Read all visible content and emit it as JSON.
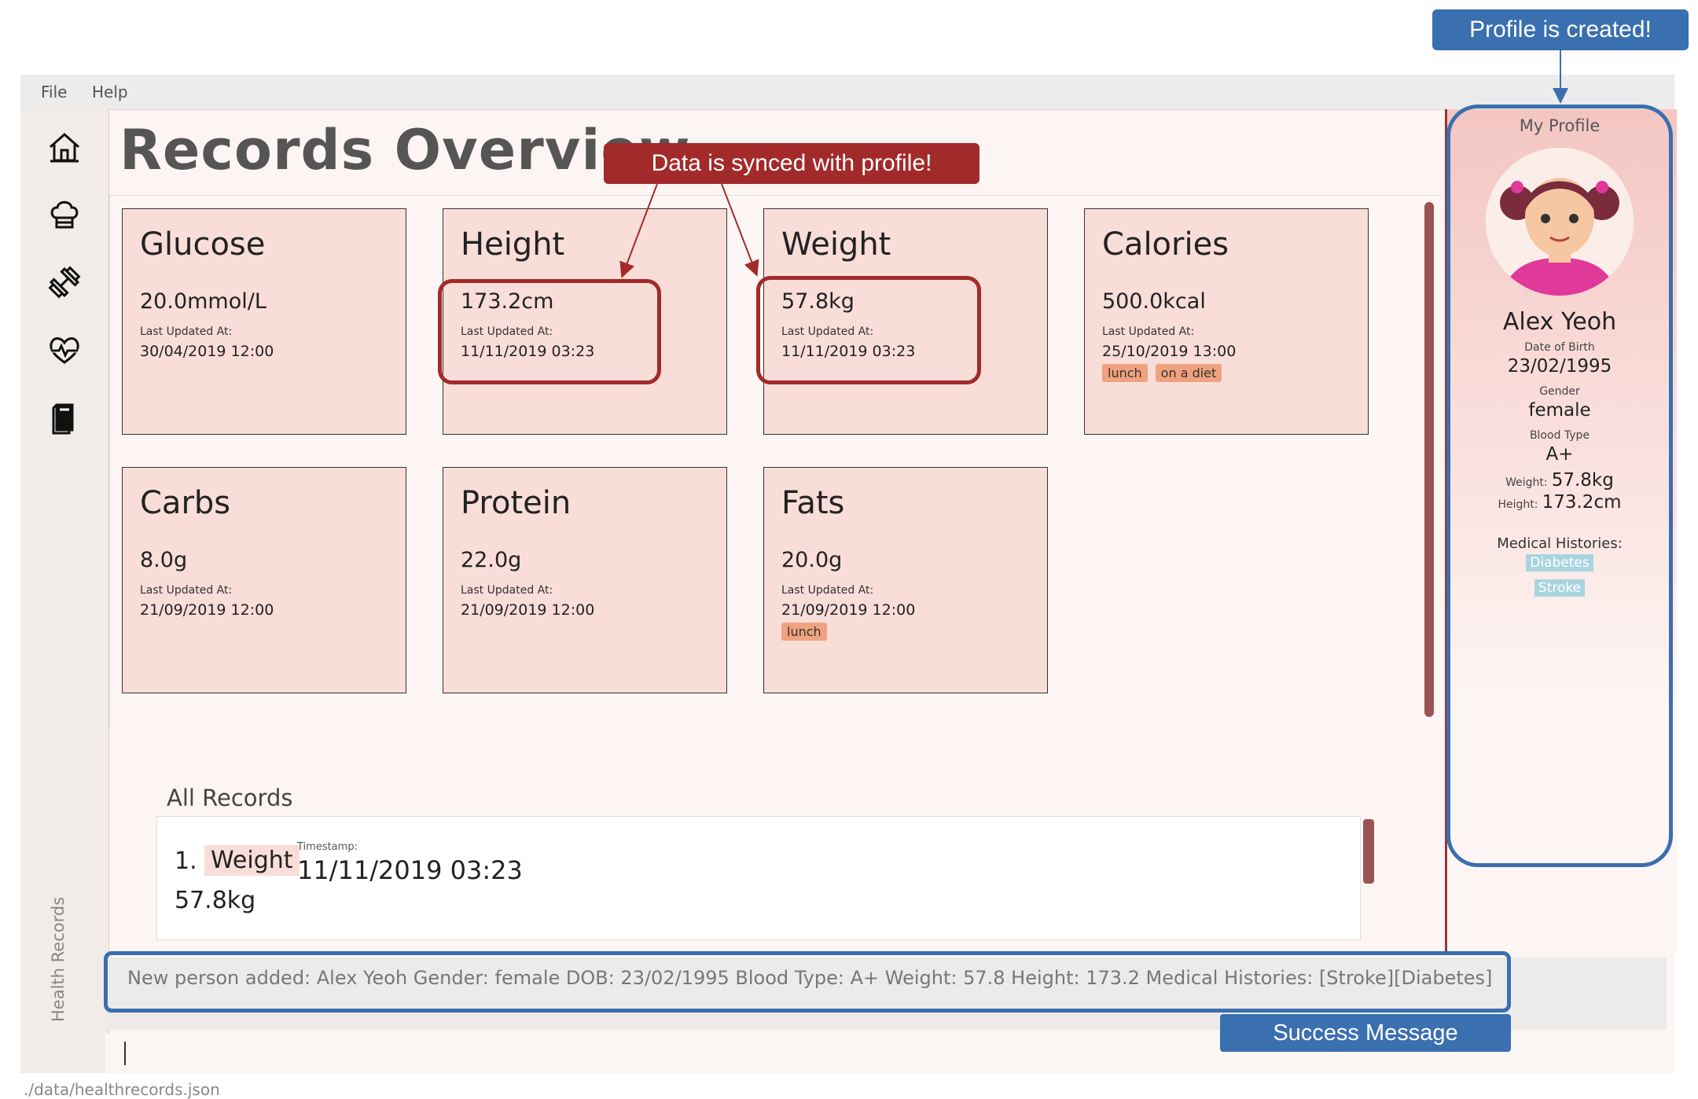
{
  "menu": {
    "file": "File",
    "help": "Help"
  },
  "sidebar": {
    "icons": [
      "home-icon",
      "chef-hat-icon",
      "dumbbell-icon",
      "heartbeat-icon",
      "book-icon"
    ],
    "vertical_label": "Health Records"
  },
  "page_title": "Records Overview",
  "cards": [
    {
      "title": "Glucose",
      "value": "20.0mmol/L",
      "updated_label": "Last Updated At:",
      "updated": "30/04/2019 12:00",
      "tags": []
    },
    {
      "title": "Height",
      "value": "173.2cm",
      "updated_label": "Last Updated At:",
      "updated": "11/11/2019 03:23",
      "tags": []
    },
    {
      "title": "Weight",
      "value": "57.8kg",
      "updated_label": "Last Updated At:",
      "updated": "11/11/2019 03:23",
      "tags": []
    },
    {
      "title": "Calories",
      "value": "500.0kcal",
      "updated_label": "Last Updated At:",
      "updated": "25/10/2019 13:00",
      "tags": [
        "lunch",
        "on a diet"
      ]
    },
    {
      "title": "Carbs",
      "value": "8.0g",
      "updated_label": "Last Updated At:",
      "updated": "21/09/2019 12:00",
      "tags": []
    },
    {
      "title": "Protein",
      "value": "22.0g",
      "updated_label": "Last Updated At:",
      "updated": "21/09/2019 12:00",
      "tags": []
    },
    {
      "title": "Fats",
      "value": "20.0g",
      "updated_label": "Last Updated At:",
      "updated": "21/09/2019 12:00",
      "tags": [
        "lunch"
      ]
    }
  ],
  "all_records": {
    "title": "All Records",
    "items": [
      {
        "index": "1.",
        "type": "Weight",
        "timestamp_label": "Timestamp:",
        "timestamp": "11/11/2019 03:23",
        "value": "57.8kg"
      }
    ]
  },
  "result_message": "New person added: Alex Yeoh Gender: female DOB: 23/02/1995 Blood Type: A+ Weight: 57.8 Height: 173.2 Medical Histories: [Stroke][Diabetes]",
  "command_input": "",
  "status_bar": "./data/healthrecords.json",
  "profile": {
    "heading": "My Profile",
    "name": "Alex Yeoh",
    "dob_label": "Date of Birth",
    "dob": "23/02/1995",
    "gender_label": "Gender",
    "gender": "female",
    "blood_label": "Blood Type",
    "blood": "A+",
    "weight_label": "Weight:",
    "weight": "57.8kg",
    "height_label": "Height:",
    "height": "173.2cm",
    "histories_label": "Medical Histories:",
    "histories": [
      "Diabetes",
      "Stroke"
    ]
  },
  "annotations": {
    "synced": "Data is synced with profile!",
    "profile_created": "Profile is created!",
    "success": "Success Message"
  },
  "colors": {
    "card": "#f9ddd9",
    "tag": "#f0a27e",
    "annotation_red": "#a32a2a",
    "annotation_blue": "#3a6fb0",
    "history_tag": "#a8d4e0"
  }
}
